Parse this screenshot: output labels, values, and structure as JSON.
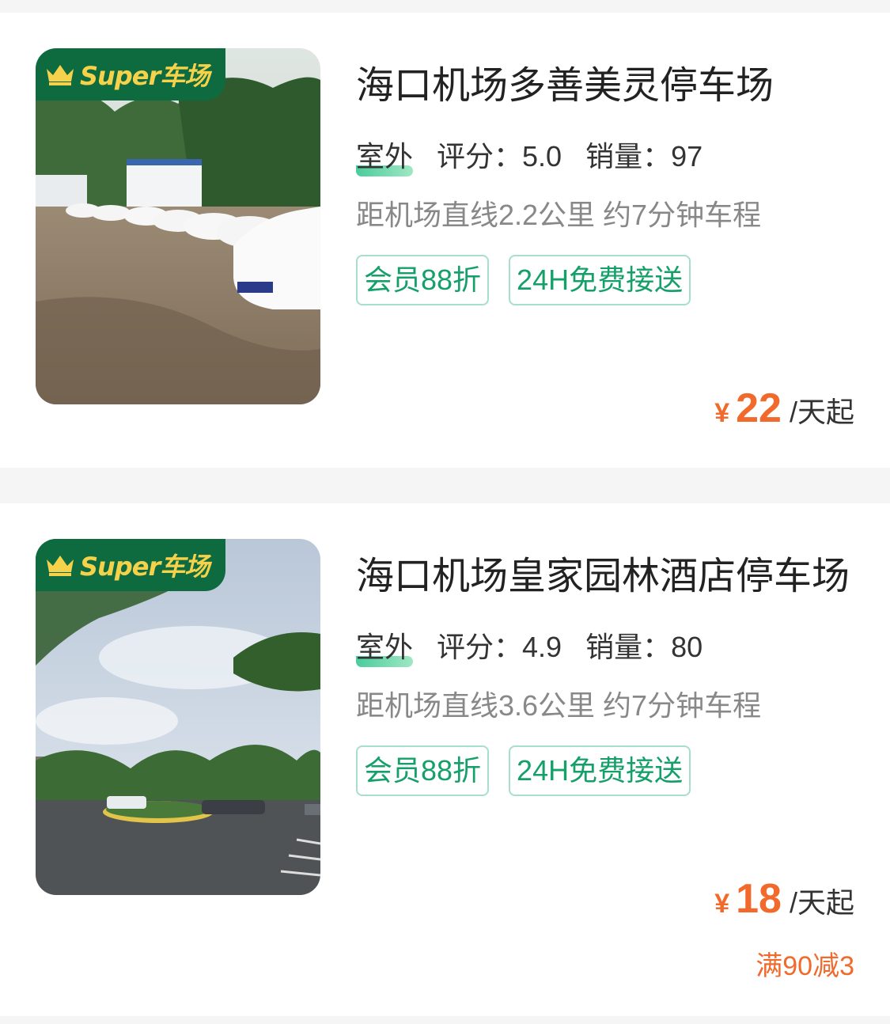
{
  "badge_text": "Super车场",
  "currency": "¥",
  "colors": {
    "brand_green": "#0e6b3f",
    "badge_gold": "#f6d24a",
    "tag_green": "#15a06a",
    "price_orange": "#f16a2b"
  },
  "lots": [
    {
      "name": "海口机场多善美灵停车场",
      "type": "室外",
      "rating": "评分：5.0",
      "sales": "销量：97",
      "distance": "距机场直线2.2公里 约7分钟车程",
      "tags": [
        "会员88折",
        "24H免费接送"
      ],
      "price": "22",
      "price_unit": "/天起",
      "promo": ""
    },
    {
      "name": "海口机场皇家园林酒店停车场",
      "type": "室外",
      "rating": "评分：4.9",
      "sales": "销量：80",
      "distance": "距机场直线3.6公里 约7分钟车程",
      "tags": [
        "会员88折",
        "24H免费接送"
      ],
      "price": "18",
      "price_unit": "/天起",
      "promo": "满90减3"
    }
  ]
}
